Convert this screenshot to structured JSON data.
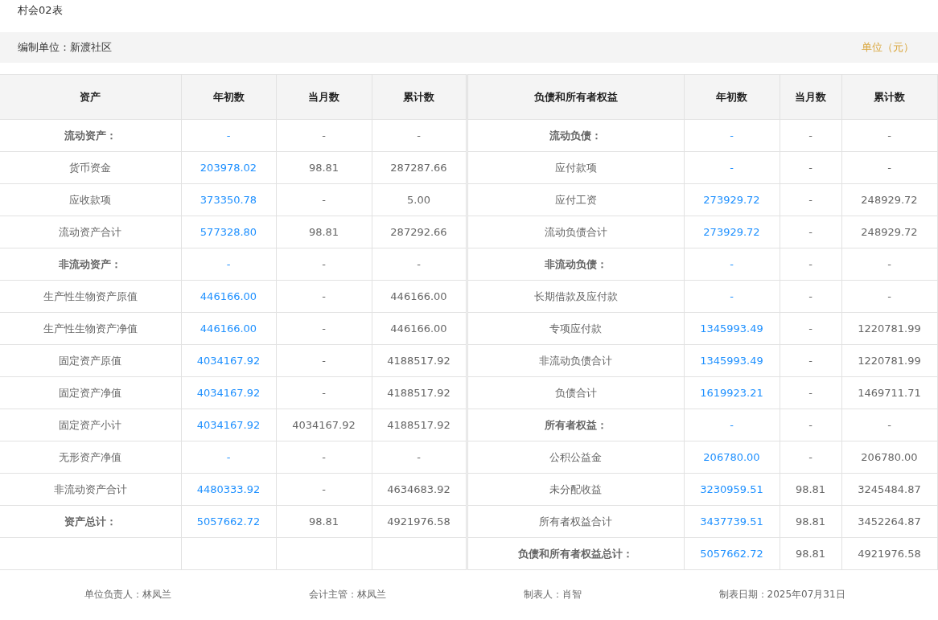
{
  "form_code": "村会02表",
  "info_bar": {
    "unit_name": "编制单位：新渡社区",
    "currency_note": "单位（元）"
  },
  "table": {
    "columns": [
      "资产",
      "年初数",
      "当月数",
      "累计数",
      "负债和所有者权益",
      "年初数",
      "当月数",
      "累计数"
    ],
    "rows": [
      {
        "left": {
          "kind": "heading",
          "label": "流动资产：",
          "opening": "-",
          "month": "-",
          "cumulative": "-"
        },
        "right": {
          "kind": "heading",
          "label": "流动负债：",
          "opening": "-",
          "month": "-",
          "cumulative": "-"
        }
      },
      {
        "left": {
          "kind": "item",
          "label": "货币资金",
          "opening": "203978.02",
          "month": "98.81",
          "cumulative": "287287.66"
        },
        "right": {
          "kind": "item",
          "label": "应付款项",
          "opening": "-",
          "month": "-",
          "cumulative": "-"
        }
      },
      {
        "left": {
          "kind": "item",
          "label": "应收款项",
          "opening": "373350.78",
          "month": "-",
          "cumulative": "5.00"
        },
        "right": {
          "kind": "item",
          "label": "应付工资",
          "opening": "273929.72",
          "month": "-",
          "cumulative": "248929.72"
        }
      },
      {
        "left": {
          "kind": "item",
          "label": "流动资产合计",
          "opening": "577328.80",
          "month": "98.81",
          "cumulative": "287292.66"
        },
        "right": {
          "kind": "item",
          "label": "流动负债合计",
          "opening": "273929.72",
          "month": "-",
          "cumulative": "248929.72"
        }
      },
      {
        "left": {
          "kind": "heading",
          "label": "非流动资产：",
          "opening": "-",
          "month": "-",
          "cumulative": "-"
        },
        "right": {
          "kind": "heading",
          "label": "非流动负债：",
          "opening": "-",
          "month": "-",
          "cumulative": "-"
        }
      },
      {
        "left": {
          "kind": "item",
          "label": "生产性生物资产原值",
          "opening": "446166.00",
          "month": "-",
          "cumulative": "446166.00"
        },
        "right": {
          "kind": "item",
          "label": "长期借款及应付款",
          "opening": "-",
          "month": "-",
          "cumulative": "-"
        }
      },
      {
        "left": {
          "kind": "item",
          "label": "生产性生物资产净值",
          "opening": "446166.00",
          "month": "-",
          "cumulative": "446166.00"
        },
        "right": {
          "kind": "item",
          "label": "专项应付款",
          "opening": "1345993.49",
          "month": "-",
          "cumulative": "1220781.99"
        }
      },
      {
        "left": {
          "kind": "item",
          "label": "固定资产原值",
          "opening": "4034167.92",
          "month": "-",
          "cumulative": "4188517.92"
        },
        "right": {
          "kind": "item",
          "label": "非流动负债合计",
          "opening": "1345993.49",
          "month": "-",
          "cumulative": "1220781.99"
        }
      },
      {
        "left": {
          "kind": "item",
          "label": "固定资产净值",
          "opening": "4034167.92",
          "month": "-",
          "cumulative": "4188517.92"
        },
        "right": {
          "kind": "item",
          "label": "负债合计",
          "opening": "1619923.21",
          "month": "-",
          "cumulative": "1469711.71"
        }
      },
      {
        "left": {
          "kind": "item",
          "label": "固定资产小计",
          "opening": "4034167.92",
          "month": "4034167.92",
          "cumulative": "4188517.92"
        },
        "right": {
          "kind": "heading",
          "label": "所有者权益：",
          "opening": "-",
          "month": "-",
          "cumulative": "-"
        }
      },
      {
        "left": {
          "kind": "item",
          "label": "无形资产净值",
          "opening": "-",
          "month": "-",
          "cumulative": "-"
        },
        "right": {
          "kind": "item",
          "label": "公积公益金",
          "opening": "206780.00",
          "month": "-",
          "cumulative": "206780.00"
        }
      },
      {
        "left": {
          "kind": "item",
          "label": "非流动资产合计",
          "opening": "4480333.92",
          "month": "-",
          "cumulative": "4634683.92"
        },
        "right": {
          "kind": "item",
          "label": "未分配收益",
          "opening": "3230959.51",
          "month": "98.81",
          "cumulative": "3245484.87"
        }
      },
      {
        "left": {
          "kind": "heading",
          "label": "资产总计：",
          "opening": "5057662.72",
          "month": "98.81",
          "cumulative": "4921976.58"
        },
        "right": {
          "kind": "item",
          "label": "所有者权益合计",
          "opening": "3437739.51",
          "month": "98.81",
          "cumulative": "3452264.87"
        }
      },
      {
        "right": {
          "kind": "heading",
          "label": "负债和所有者权益总计：",
          "opening": "5057662.72",
          "month": "98.81",
          "cumulative": "4921976.58"
        }
      }
    ]
  },
  "signatures": [
    "单位负责人：林凤兰",
    "会计主管：林凤兰",
    "制表人：肖智",
    "制表日期：2025年07月31日"
  ]
}
